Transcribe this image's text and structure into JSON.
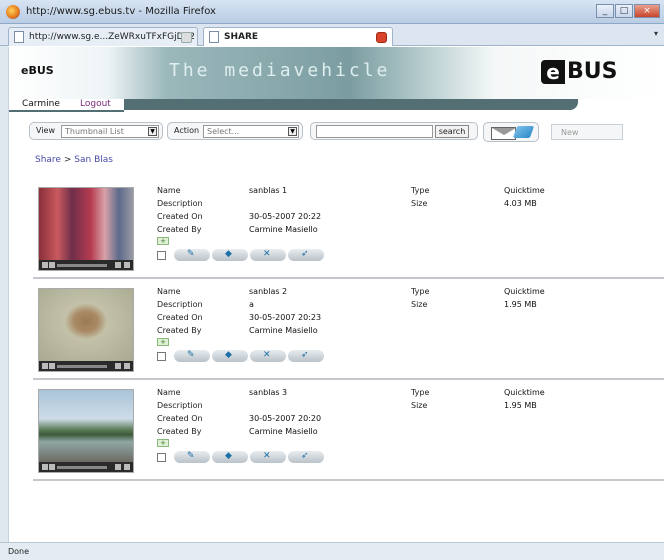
{
  "window": {
    "title": "http://www.sg.ebus.tv - Mozilla Firefox",
    "controls": {
      "minimize": "_",
      "maximize": "□",
      "close": "×"
    }
  },
  "tabs": [
    {
      "label": "http://www.sg.e...ZeWRxuTFxFGjD52",
      "active": false
    },
    {
      "label": "SHARE",
      "active": true
    }
  ],
  "banner": {
    "brand": "eBUS",
    "tagline": "The mediavehicle",
    "logo_letter": "e",
    "logo_text": "BUS"
  },
  "user_nav": {
    "user": "Carmine",
    "logout": "Logout"
  },
  "toolbar": {
    "view_label": "View",
    "view_value": "Thumbnail List",
    "action_label": "Action",
    "action_value": "Select...",
    "search_value": "",
    "search_button": "search",
    "new_button": "New"
  },
  "breadcrumb": {
    "root": "Share",
    "separator": ">",
    "current": "San Blas"
  },
  "labels": {
    "name": "Name",
    "description": "Description",
    "created_on": "Created On",
    "created_by": "Created By",
    "type": "Type",
    "size": "Size"
  },
  "items": [
    {
      "name": "sanblas 1",
      "description": "",
      "created_on": "30-05-2007 20:22",
      "created_by": "Carmine Masiello",
      "type": "Quicktime",
      "size": "4.03 MB"
    },
    {
      "name": "sanblas 2",
      "description": "a",
      "created_on": "30-05-2007 20:23",
      "created_by": "Carmine Masiello",
      "type": "Quicktime",
      "size": "1.95 MB"
    },
    {
      "name": "sanblas 3",
      "description": "",
      "created_on": "30-05-2007 20:20",
      "created_by": "Carmine Masiello",
      "type": "Quicktime",
      "size": "1.95 MB"
    }
  ],
  "status": "Done",
  "colors": {
    "nav_bar": "#536f73",
    "logout_link": "#7a2a7a",
    "breadcrumb_link": "#4a4aa8"
  }
}
